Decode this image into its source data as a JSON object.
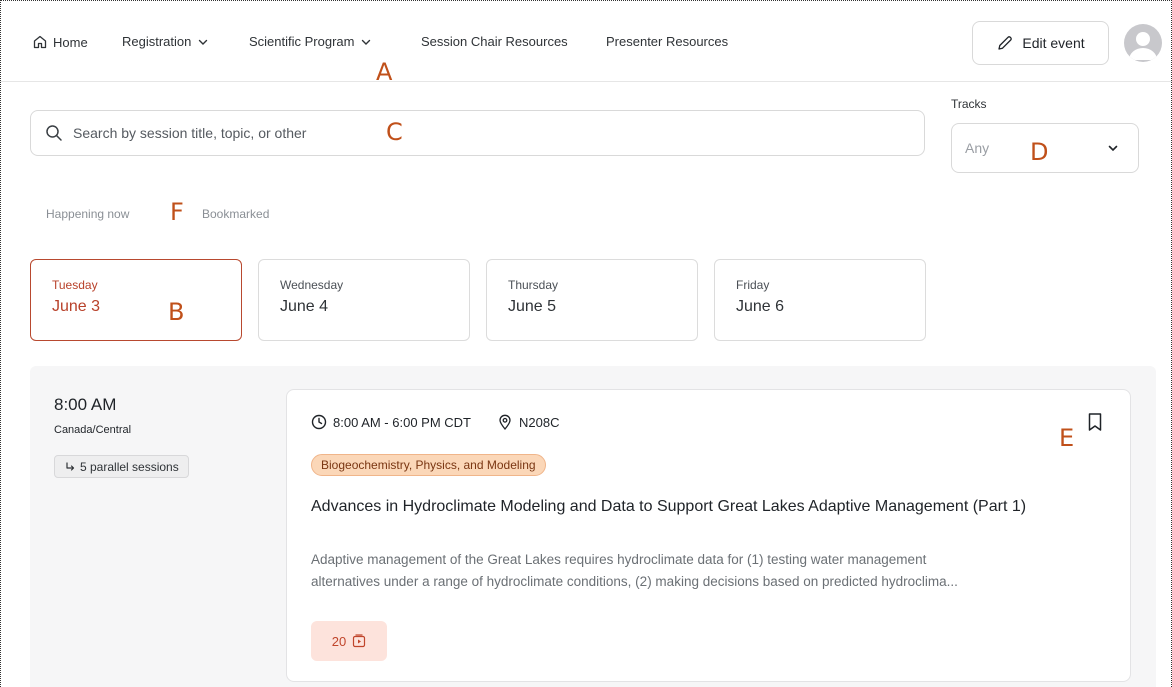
{
  "nav": {
    "home": "Home",
    "registration": "Registration",
    "scientific_program": "Scientific Program",
    "session_chair": "Session Chair Resources",
    "presenter": "Presenter Resources",
    "edit_event": "Edit event"
  },
  "search": {
    "placeholder": "Search by session title, topic, or other"
  },
  "tracks": {
    "label": "Tracks",
    "value": "Any"
  },
  "filters": {
    "happening_now": "Happening now",
    "bookmarked": "Bookmarked"
  },
  "days": [
    {
      "dow": "Tuesday",
      "date": "June 3"
    },
    {
      "dow": "Wednesday",
      "date": "June 4"
    },
    {
      "dow": "Thursday",
      "date": "June 5"
    },
    {
      "dow": "Friday",
      "date": "June 6"
    }
  ],
  "timeslot": {
    "time": "8:00 AM",
    "timezone": "Canada/Central",
    "parallel": "5 parallel sessions"
  },
  "session": {
    "time_range": "8:00 AM - 6:00 PM CDT",
    "room": "N208C",
    "tag": "Biogeochemistry, Physics, and Modeling",
    "title": "Advances in Hydroclimate Modeling and Data to Support Great Lakes Adaptive Management (Part 1)",
    "description_line1": "Adaptive management of the Great Lakes requires hydroclimate data for (1) testing water management",
    "description_line2": "alternatives under a range of hydroclimate conditions, (2) making decisions based on predicted hydroclima...",
    "presentation_count": "20"
  },
  "markers": {
    "a": "A",
    "b": "B",
    "c": "C",
    "d": "D",
    "e": "E",
    "f": "F"
  },
  "colors": {
    "accent": "#b8412a",
    "tag_bg": "#fbd7b8",
    "badge_bg": "#fde3dc",
    "marker": "#c0501a"
  }
}
